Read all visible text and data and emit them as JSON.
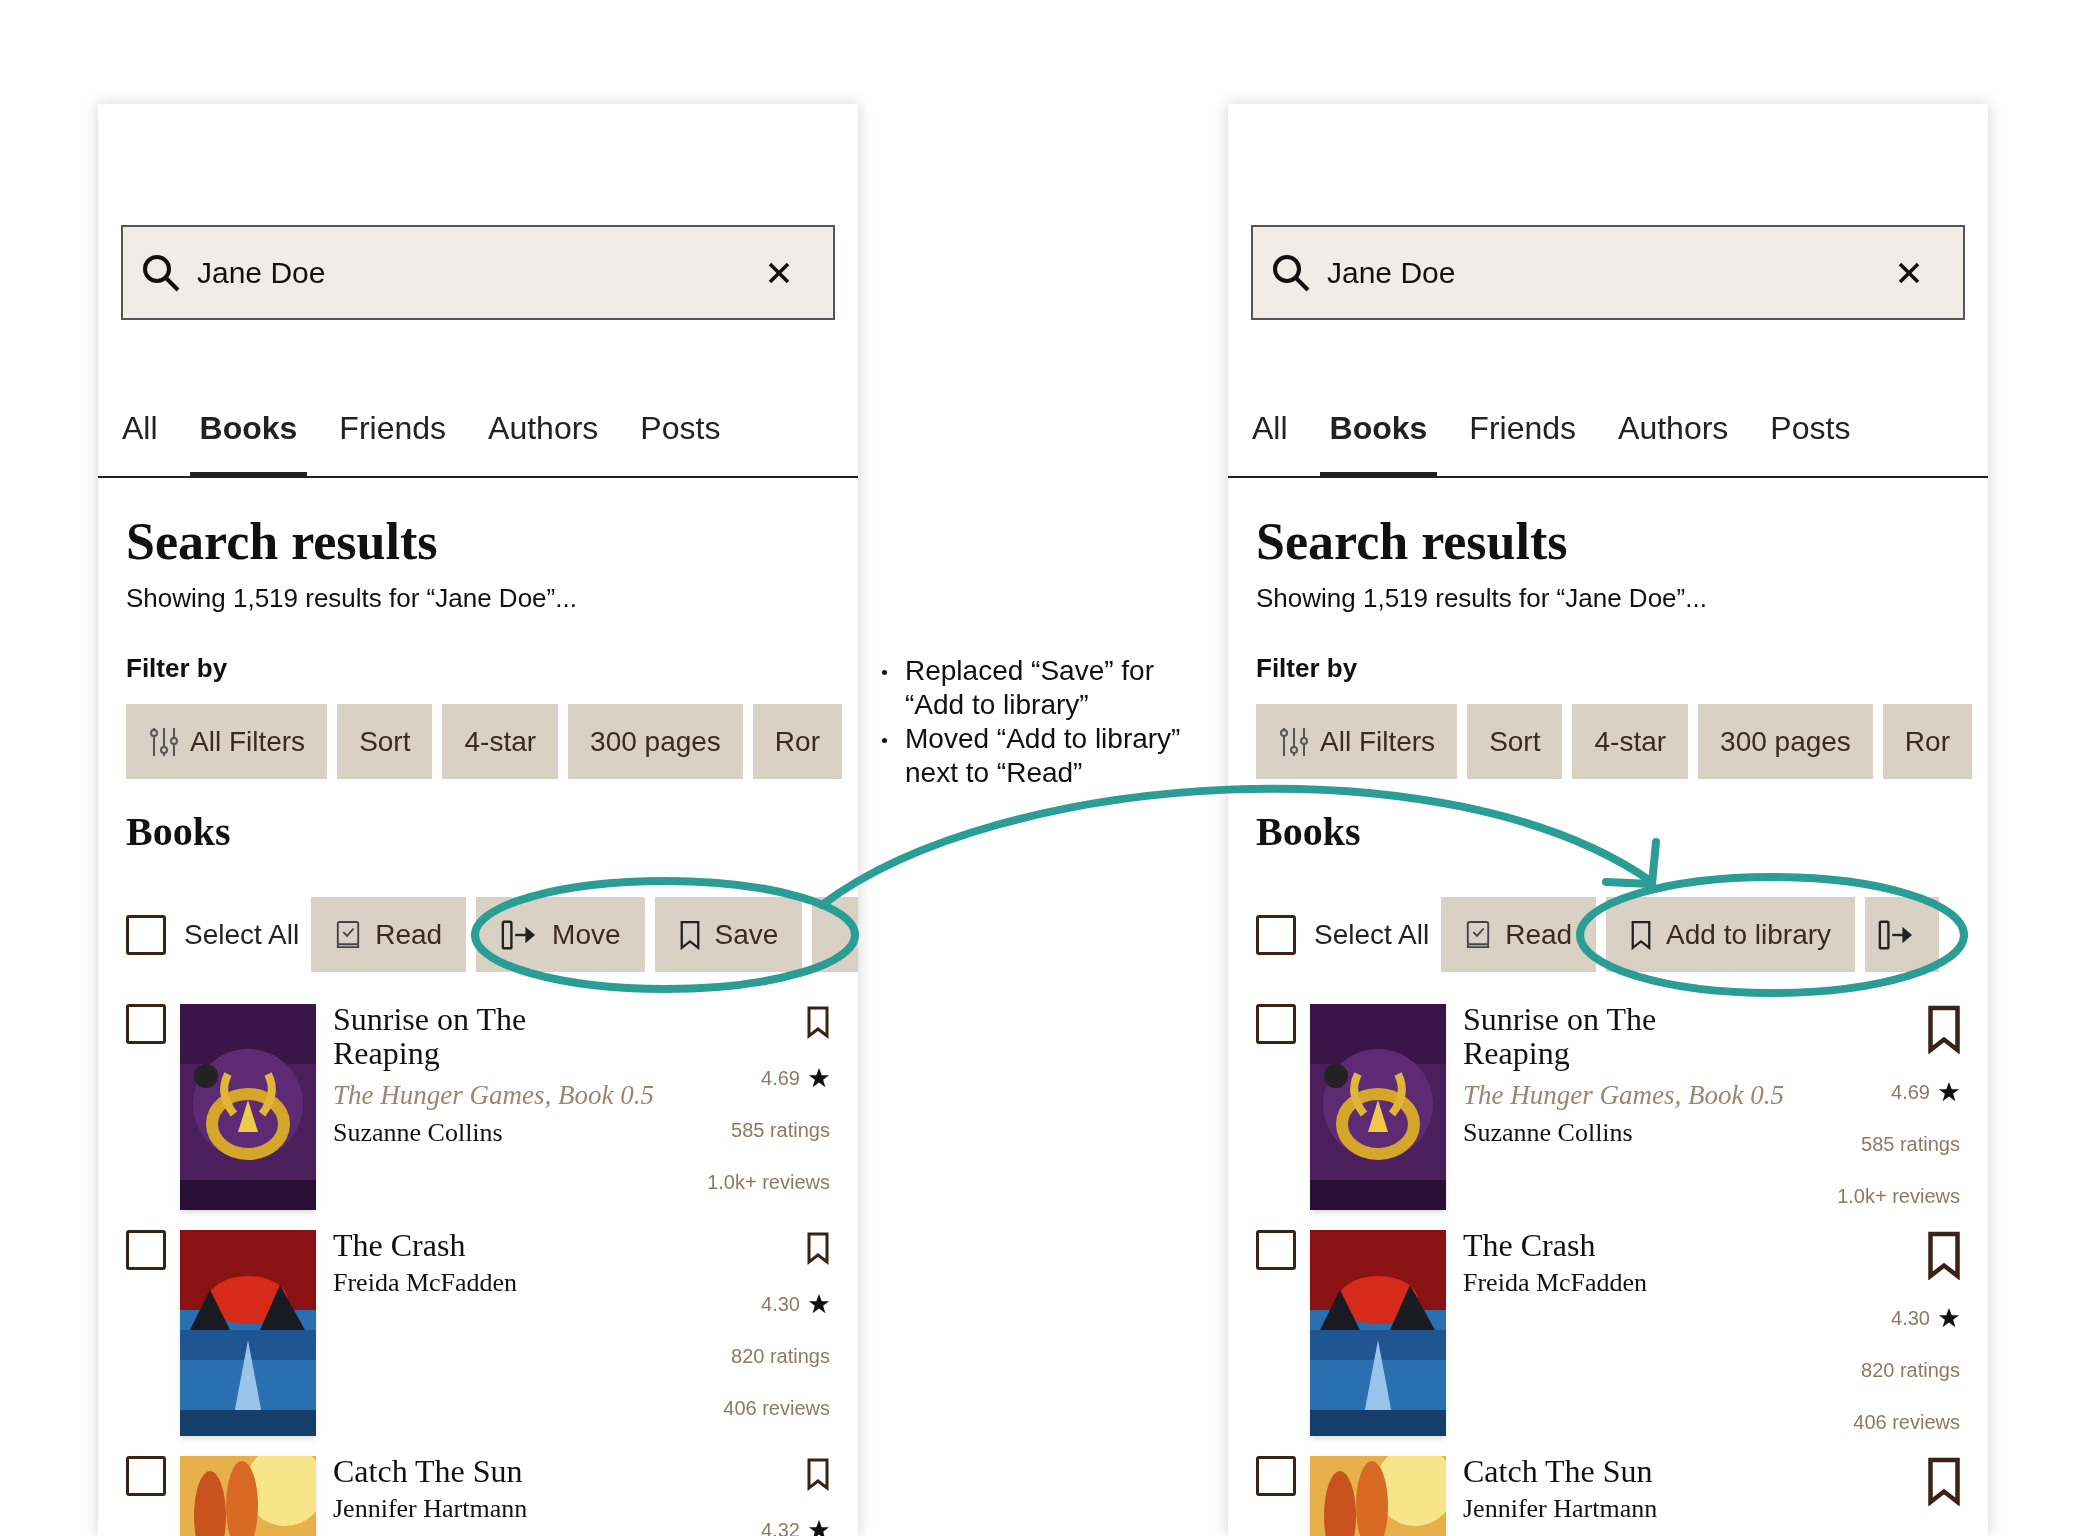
{
  "mockups": [
    {
      "large_bookmarks": false,
      "search": {
        "value": "Jane Doe"
      },
      "tabs": [
        {
          "label": "All",
          "selected": false
        },
        {
          "label": "Books",
          "selected": true
        },
        {
          "label": "Friends",
          "selected": false
        },
        {
          "label": "Authors",
          "selected": false
        },
        {
          "label": "Posts",
          "selected": false
        }
      ],
      "heading": "Search results",
      "summary": "Showing 1,519 results for “Jane Doe”...",
      "filter_label": "Filter by",
      "filters": [
        {
          "label": "All Filters",
          "kind": "sliders"
        },
        {
          "label": "Sort",
          "kind": "plain"
        },
        {
          "label": "4-star",
          "kind": "plain"
        },
        {
          "label": "300 pages",
          "kind": "plain"
        },
        {
          "label": "Ror",
          "kind": "plain"
        }
      ],
      "section_title": "Books",
      "select_all": {
        "label": "Select All",
        "checked": false
      },
      "actions": [
        {
          "label": "Read",
          "kind": "read"
        },
        {
          "label": "Move",
          "kind": "move"
        },
        {
          "label": "Save",
          "kind": "bookmark"
        },
        {
          "kind": "cut"
        }
      ],
      "books": [
        {
          "title": "Sunrise on The Reaping",
          "series": "The Hunger Games, Book 0.5",
          "author": "Suzanne Collins",
          "rating": "4.69",
          "ratings": "585 ratings",
          "reviews": "1.0k+ reviews",
          "checked": false
        },
        {
          "title": "The Crash",
          "author": "Freida McFadden",
          "rating": "4.30",
          "ratings": "820 ratings",
          "reviews": "406 reviews",
          "checked": false
        },
        {
          "title": "Catch The Sun",
          "author": "Jennifer Hartmann",
          "rating": "4.32",
          "checked": false
        }
      ]
    },
    {
      "large_bookmarks": true,
      "search": {
        "value": "Jane Doe"
      },
      "tabs": [
        {
          "label": "All",
          "selected": false
        },
        {
          "label": "Books",
          "selected": true
        },
        {
          "label": "Friends",
          "selected": false
        },
        {
          "label": "Authors",
          "selected": false
        },
        {
          "label": "Posts",
          "selected": false
        }
      ],
      "heading": "Search results",
      "summary": "Showing 1,519 results for “Jane Doe”...",
      "filter_label": "Filter by",
      "filters": [
        {
          "label": "All Filters",
          "kind": "sliders"
        },
        {
          "label": "Sort",
          "kind": "plain"
        },
        {
          "label": "4-star",
          "kind": "plain"
        },
        {
          "label": "300 pages",
          "kind": "plain"
        },
        {
          "label": "Ror",
          "kind": "plain"
        }
      ],
      "section_title": "Books",
      "select_all": {
        "label": "Select All",
        "checked": false
      },
      "actions": [
        {
          "label": "Read",
          "kind": "read"
        },
        {
          "label": "Add to library",
          "kind": "bookmark"
        },
        {
          "kind": "move"
        }
      ],
      "books": [
        {
          "title": "Sunrise on The Reaping",
          "series": "The Hunger Games, Book 0.5",
          "author": "Suzanne Collins",
          "rating": "4.69",
          "ratings": "585 ratings",
          "reviews": "1.0k+ reviews",
          "checked": false
        },
        {
          "title": "The Crash",
          "author": "Freida McFadden",
          "rating": "4.30",
          "ratings": "820 ratings",
          "reviews": "406 reviews",
          "checked": false
        },
        {
          "title": "Catch The Sun",
          "author": "Jennifer Hartmann",
          "checked": false
        }
      ]
    }
  ],
  "notes": [
    "Replaced “Save” for “Add to library”",
    "Moved “Add to library” next to “Read”"
  ]
}
